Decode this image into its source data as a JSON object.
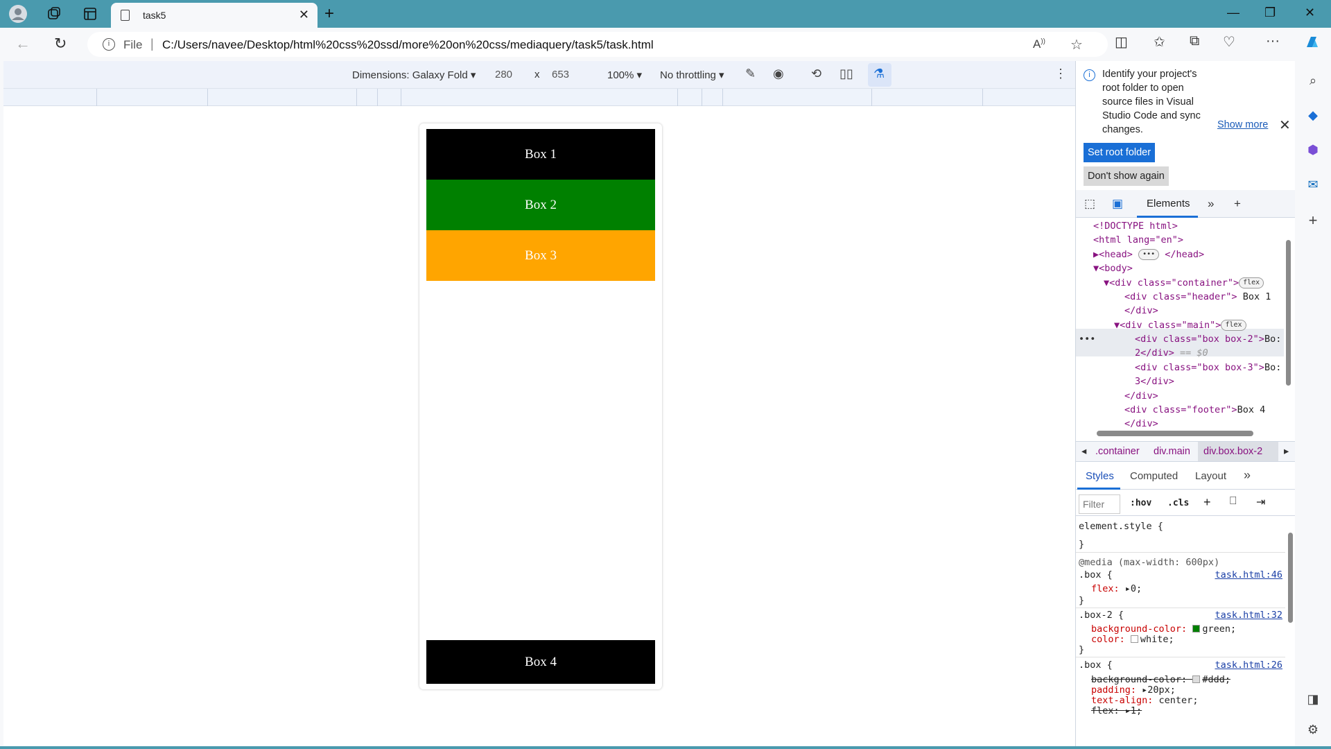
{
  "browser": {
    "tab_title": "task5",
    "file_label": "File",
    "url": "C:/Users/navee/Desktop/html%20css%20ssd/more%20on%20css/mediaquery/task5/task.html"
  },
  "device_toolbar": {
    "dimensions": "Dimensions: Galaxy Fold",
    "width": "280",
    "times": "x",
    "height": "653",
    "zoom": "100%",
    "throttling": "No throttling"
  },
  "page": {
    "boxes": [
      {
        "label": "Box 1",
        "color": "#000000"
      },
      {
        "label": "Box 2",
        "color": "#008000"
      },
      {
        "label": "Box 3",
        "color": "#ffa500"
      },
      {
        "label": "Box 4",
        "color": "#000000"
      }
    ]
  },
  "devtools": {
    "banner": {
      "message": "Identify your project's root folder to open source files in Visual Studio Code and sync changes.",
      "show_more": "Show more",
      "set_root": "Set root folder",
      "dont_show": "Don't show again"
    },
    "tab_elements": "Elements",
    "dom": [
      "<!DOCTYPE html>",
      "<html lang=\"en\">",
      "<head>",
      "</head>",
      "<body>",
      "<div class=\"container\">",
      "flex",
      "<div class=\"header\">",
      "Box 1",
      "</div>",
      "<div class=\"main\">",
      "flex",
      "<div class=\"box box-2\">",
      "Bo:",
      "2</div>",
      "== $0",
      "<div class=\"box box-3\">",
      "Bo:",
      "3</div>",
      "</div>",
      "<div class=\"footer\">",
      "Box 4",
      "</div>"
    ],
    "breadcrumbs": [
      ".container",
      "div.main",
      "div.box.box-2"
    ],
    "style_tabs": [
      "Styles",
      "Computed",
      "Layout"
    ],
    "filter_placeholder": "Filter",
    "hov": ":hov",
    "cls": ".cls",
    "styles": {
      "element_style": "element.style {",
      "close": "}",
      "media": "@media (max-width: 600px)",
      "rule1_selector": ".box {",
      "rule1_src": "task.html:46",
      "rule1_prop": "flex: ",
      "rule1_val": "0;",
      "rule2_selector": ".box-2 {",
      "rule2_src": "task.html:32",
      "rule2_prop1": "background-color: ",
      "rule2_val1": "green;",
      "rule2_prop2": "color: ",
      "rule2_val2": "white;",
      "rule3_selector": ".box {",
      "rule3_src": "task.html:26",
      "rule3_prop1": "background-color: ",
      "rule3_val1": "#ddd;",
      "rule3_prop2": "padding: ",
      "rule3_val2": "20px;",
      "rule3_prop3": "text-align: ",
      "rule3_val3": "center;",
      "rule3_prop4": "flex: ",
      "rule3_val4": "1;"
    }
  }
}
